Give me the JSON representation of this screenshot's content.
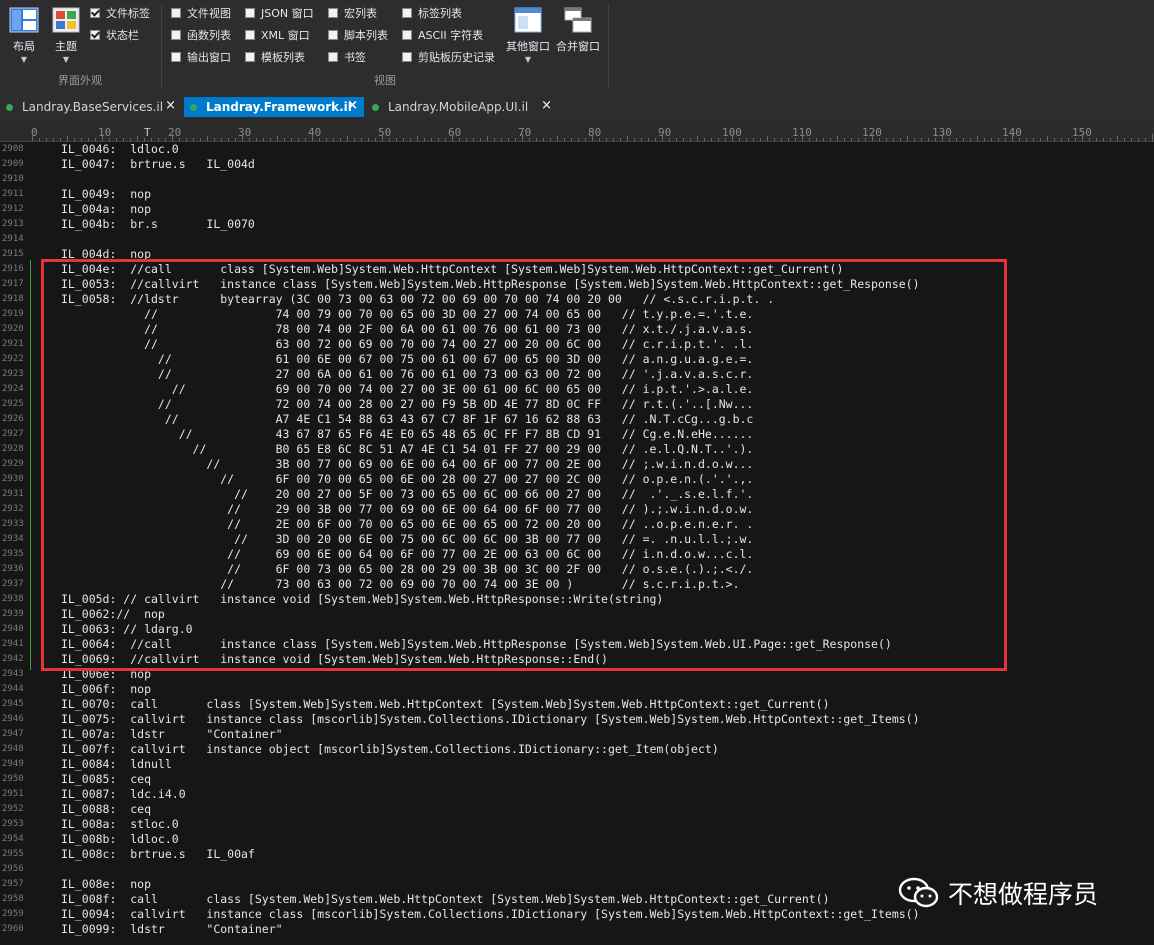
{
  "ribbon": {
    "layout_label": "布局",
    "theme_label": "主题",
    "file_tabs_label": "文件标签",
    "status_bar_label": "状态栏",
    "group_appearance": "界面外观",
    "view_checks": [
      {
        "label": "文件视图",
        "checked": false
      },
      {
        "label": "JSON 窗口",
        "checked": false
      },
      {
        "label": "宏列表",
        "checked": false
      },
      {
        "label": "标签列表",
        "checked": false
      },
      {
        "label": "函数列表",
        "checked": false
      },
      {
        "label": "XML 窗口",
        "checked": false
      },
      {
        "label": "脚本列表",
        "checked": false
      },
      {
        "label": "ASCII 字符表",
        "checked": false
      },
      {
        "label": "输出窗口",
        "checked": false
      },
      {
        "label": "模板列表",
        "checked": false
      },
      {
        "label": "书签",
        "checked": false
      },
      {
        "label": "剪贴板历史记录",
        "checked": false
      }
    ],
    "other_windows_label": "其他窗口",
    "merge_windows_label": "合并窗口",
    "group_view": "视图"
  },
  "tabs": [
    {
      "label": "Landray.BaseServices.il",
      "close": "×",
      "active": false
    },
    {
      "label": "Landray.Framework.il",
      "close": "×",
      "active": true
    },
    {
      "label": "Landray.MobileApp.UI.il",
      "close": "×",
      "active": false
    }
  ],
  "ruler": [
    "0",
    "10",
    "20",
    "30",
    "40",
    "50",
    "60",
    "70",
    "80",
    "90",
    "100",
    "110",
    "120",
    "130",
    "140",
    "150"
  ],
  "lines": [
    {
      "n": "2908",
      "t": "IL_0046:  ldloc.0"
    },
    {
      "n": "2909",
      "t": "IL_0047:  brtrue.s   IL_004d"
    },
    {
      "n": "2910",
      "t": ""
    },
    {
      "n": "2911",
      "t": "IL_0049:  nop"
    },
    {
      "n": "2912",
      "t": "IL_004a:  nop"
    },
    {
      "n": "2913",
      "t": "IL_004b:  br.s       IL_0070"
    },
    {
      "n": "2914",
      "t": ""
    },
    {
      "n": "2915",
      "t": "IL_004d:  nop"
    },
    {
      "n": "2916",
      "t": "IL_004e:  //call       class [System.Web]System.Web.HttpContext [System.Web]System.Web.HttpContext::get_Current()"
    },
    {
      "n": "2917",
      "t": "IL_0053:  //callvirt   instance class [System.Web]System.Web.HttpResponse [System.Web]System.Web.HttpContext::get_Response()"
    },
    {
      "n": "2918",
      "t": "IL_0058:  //ldstr      bytearray (3C 00 73 00 63 00 72 00 69 00 70 00 74 00 20 00   // <.s.c.r.i.p.t. ."
    },
    {
      "n": "2919",
      "t": "            //                 74 00 79 00 70 00 65 00 3D 00 27 00 74 00 65 00   // t.y.p.e.=.'.t.e."
    },
    {
      "n": "2920",
      "t": "            //                 78 00 74 00 2F 00 6A 00 61 00 76 00 61 00 73 00   // x.t./.j.a.v.a.s."
    },
    {
      "n": "2921",
      "t": "            //                 63 00 72 00 69 00 70 00 74 00 27 00 20 00 6C 00   // c.r.i.p.t.'. .l."
    },
    {
      "n": "2922",
      "t": "              //               61 00 6E 00 67 00 75 00 61 00 67 00 65 00 3D 00   // a.n.g.u.a.g.e.=."
    },
    {
      "n": "2923",
      "t": "              //               27 00 6A 00 61 00 76 00 61 00 73 00 63 00 72 00   // '.j.a.v.a.s.c.r."
    },
    {
      "n": "2924",
      "t": "                //             69 00 70 00 74 00 27 00 3E 00 61 00 6C 00 65 00   // i.p.t.'.>.a.l.e."
    },
    {
      "n": "2925",
      "t": "              //               72 00 74 00 28 00 27 00 F9 5B 0D 4E 77 8D 0C FF   // r.t.(.'..[.Nw..."
    },
    {
      "n": "2926",
      "t": "               //              A7 4E C1 54 88 63 43 67 C7 8F 1F 67 16 62 88 63   // .N.T.cCg...g.b.c"
    },
    {
      "n": "2927",
      "t": "                 //            43 67 87 65 F6 4E E0 65 48 65 0C FF F7 8B CD 91   // Cg.e.N.eHe......"
    },
    {
      "n": "2928",
      "t": "                   //          B0 65 E8 6C 8C 51 A7 4E C1 54 01 FF 27 00 29 00   // .e.l.Q.N.T..'.)."
    },
    {
      "n": "2929",
      "t": "                     //        3B 00 77 00 69 00 6E 00 64 00 6F 00 77 00 2E 00   // ;.w.i.n.d.o.w..."
    },
    {
      "n": "2930",
      "t": "                       //      6F 00 70 00 65 00 6E 00 28 00 27 00 27 00 2C 00   // o.p.e.n.(.'.'.,."
    },
    {
      "n": "2931",
      "t": "                         //    20 00 27 00 5F 00 73 00 65 00 6C 00 66 00 27 00   //  .'._.s.e.l.f.'."
    },
    {
      "n": "2932",
      "t": "                        //     29 00 3B 00 77 00 69 00 6E 00 64 00 6F 00 77 00   // ).;.w.i.n.d.o.w."
    },
    {
      "n": "2933",
      "t": "                        //     2E 00 6F 00 70 00 65 00 6E 00 65 00 72 00 20 00   // ..o.p.e.n.e.r. ."
    },
    {
      "n": "2934",
      "t": "                         //    3D 00 20 00 6E 00 75 00 6C 00 6C 00 3B 00 77 00   // =. .n.u.l.l.;.w."
    },
    {
      "n": "2935",
      "t": "                        //     69 00 6E 00 64 00 6F 00 77 00 2E 00 63 00 6C 00   // i.n.d.o.w...c.l."
    },
    {
      "n": "2936",
      "t": "                        //     6F 00 73 00 65 00 28 00 29 00 3B 00 3C 00 2F 00   // o.s.e.(.).;.<./."
    },
    {
      "n": "2937",
      "t": "                       //      73 00 63 00 72 00 69 00 70 00 74 00 3E 00 )       // s.c.r.i.p.t.>."
    },
    {
      "n": "2938",
      "t": "IL_005d: // callvirt   instance void [System.Web]System.Web.HttpResponse::Write(string)"
    },
    {
      "n": "2939",
      "t": "IL_0062://  nop"
    },
    {
      "n": "2940",
      "t": "IL_0063: // ldarg.0"
    },
    {
      "n": "2941",
      "t": "IL_0064:  //call       instance class [System.Web]System.Web.HttpResponse [System.Web]System.Web.UI.Page::get_Response()"
    },
    {
      "n": "2942",
      "t": "IL_0069:  //callvirt   instance void [System.Web]System.Web.HttpResponse::End()"
    },
    {
      "n": "2943",
      "t": "IL_006e:  nop"
    },
    {
      "n": "2944",
      "t": "IL_006f:  nop"
    },
    {
      "n": "2945",
      "t": "IL_0070:  call       class [System.Web]System.Web.HttpContext [System.Web]System.Web.HttpContext::get_Current()"
    },
    {
      "n": "2946",
      "t": "IL_0075:  callvirt   instance class [mscorlib]System.Collections.IDictionary [System.Web]System.Web.HttpContext::get_Items()"
    },
    {
      "n": "2947",
      "t": "IL_007a:  ldstr      \"Container\""
    },
    {
      "n": "2948",
      "t": "IL_007f:  callvirt   instance object [mscorlib]System.Collections.IDictionary::get_Item(object)"
    },
    {
      "n": "2949",
      "t": "IL_0084:  ldnull"
    },
    {
      "n": "2950",
      "t": "IL_0085:  ceq"
    },
    {
      "n": "2951",
      "t": "IL_0087:  ldc.i4.0"
    },
    {
      "n": "2952",
      "t": "IL_0088:  ceq"
    },
    {
      "n": "2953",
      "t": "IL_008a:  stloc.0"
    },
    {
      "n": "2954",
      "t": "IL_008b:  ldloc.0"
    },
    {
      "n": "2955",
      "t": "IL_008c:  brtrue.s   IL_00af"
    },
    {
      "n": "2956",
      "t": ""
    },
    {
      "n": "2957",
      "t": "IL_008e:  nop"
    },
    {
      "n": "2958",
      "t": "IL_008f:  call       class [System.Web]System.Web.HttpContext [System.Web]System.Web.HttpContext::get_Current()"
    },
    {
      "n": "2959",
      "t": "IL_0094:  callvirt   instance class [mscorlib]System.Collections.IDictionary [System.Web]System.Web.HttpContext::get_Items()"
    },
    {
      "n": "2960",
      "t": "IL_0099:  ldstr      \"Container\""
    }
  ],
  "watermark": {
    "text": "不想做程序员"
  }
}
